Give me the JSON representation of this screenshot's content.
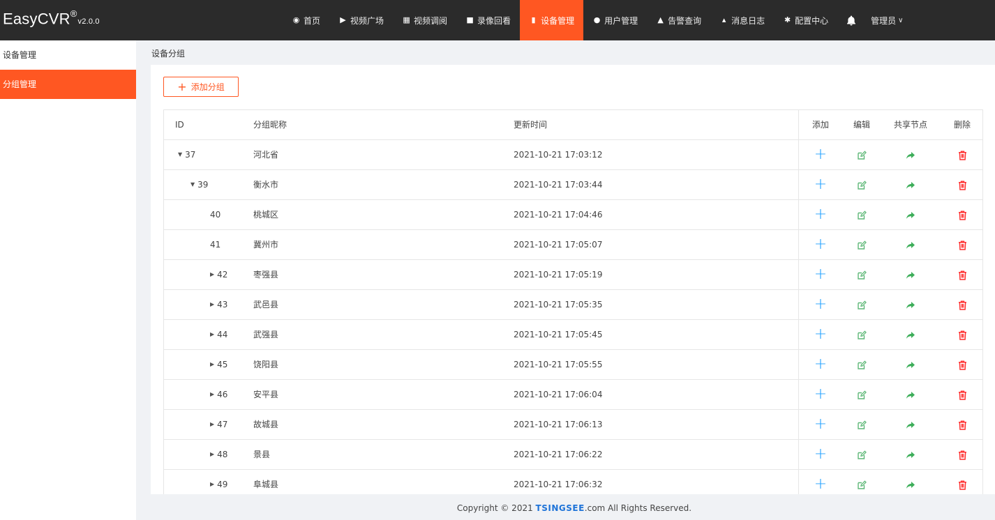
{
  "brand": {
    "name": "EasyCVR",
    "reg": "®",
    "version": "v2.0.0"
  },
  "nav": [
    {
      "label": "首页",
      "icon": "dashboard-icon"
    },
    {
      "label": "视频广场",
      "icon": "play-circle-icon"
    },
    {
      "label": "视频调阅",
      "icon": "layout-icon"
    },
    {
      "label": "录像回看",
      "icon": "video-camera-icon"
    },
    {
      "label": "设备管理",
      "icon": "device-icon",
      "active": true
    },
    {
      "label": "用户管理",
      "icon": "user-icon"
    },
    {
      "label": "告警查询",
      "icon": "alarm-icon"
    },
    {
      "label": "消息日志",
      "icon": "bell-small-icon"
    },
    {
      "label": "配置中心",
      "icon": "gear-icon"
    }
  ],
  "user": {
    "label": "管理员"
  },
  "sidebar": {
    "items": [
      {
        "label": "设备管理"
      },
      {
        "label": "分组管理",
        "active": true
      }
    ]
  },
  "breadcrumb": "设备分组",
  "add_button": {
    "label": "添加分组"
  },
  "table": {
    "headers": {
      "id": "ID",
      "name": "分组昵称",
      "time": "更新时间",
      "add": "添加",
      "edit": "编辑",
      "share": "共享节点",
      "delete": "删除"
    },
    "rows": [
      {
        "id": "37",
        "name": "河北省",
        "time": "2021-10-21 17:03:12",
        "level": 0,
        "toggle": "expanded"
      },
      {
        "id": "39",
        "name": "衡水市",
        "time": "2021-10-21 17:03:44",
        "level": 1,
        "toggle": "expanded"
      },
      {
        "id": "40",
        "name": "桃城区",
        "time": "2021-10-21 17:04:46",
        "level": 2,
        "toggle": "none"
      },
      {
        "id": "41",
        "name": "冀州市",
        "time": "2021-10-21 17:05:07",
        "level": 2,
        "toggle": "none"
      },
      {
        "id": "42",
        "name": "枣强县",
        "time": "2021-10-21 17:05:19",
        "level": 2,
        "toggle": "collapsed"
      },
      {
        "id": "43",
        "name": "武邑县",
        "time": "2021-10-21 17:05:35",
        "level": 2,
        "toggle": "collapsed"
      },
      {
        "id": "44",
        "name": "武强县",
        "time": "2021-10-21 17:05:45",
        "level": 2,
        "toggle": "collapsed"
      },
      {
        "id": "45",
        "name": "饶阳县",
        "time": "2021-10-21 17:05:55",
        "level": 2,
        "toggle": "collapsed"
      },
      {
        "id": "46",
        "name": "安平县",
        "time": "2021-10-21 17:06:04",
        "level": 2,
        "toggle": "collapsed"
      },
      {
        "id": "47",
        "name": "故城县",
        "time": "2021-10-21 17:06:13",
        "level": 2,
        "toggle": "collapsed"
      },
      {
        "id": "48",
        "name": "景县",
        "time": "2021-10-21 17:06:22",
        "level": 2,
        "toggle": "collapsed"
      },
      {
        "id": "49",
        "name": "阜城县",
        "time": "2021-10-21 17:06:32",
        "level": 2,
        "toggle": "collapsed"
      }
    ]
  },
  "footer": {
    "prefix": "Copyright © 2021 ",
    "logo": "TSINGSEE",
    "suffix": ".com All Rights Reserved."
  },
  "colors": {
    "accent": "#ff5722",
    "add": "#1e9fff",
    "edit": "#5fb878",
    "share": "#4caf50",
    "delete": "#ff2b2b",
    "header_bg": "#2b2b2b"
  }
}
